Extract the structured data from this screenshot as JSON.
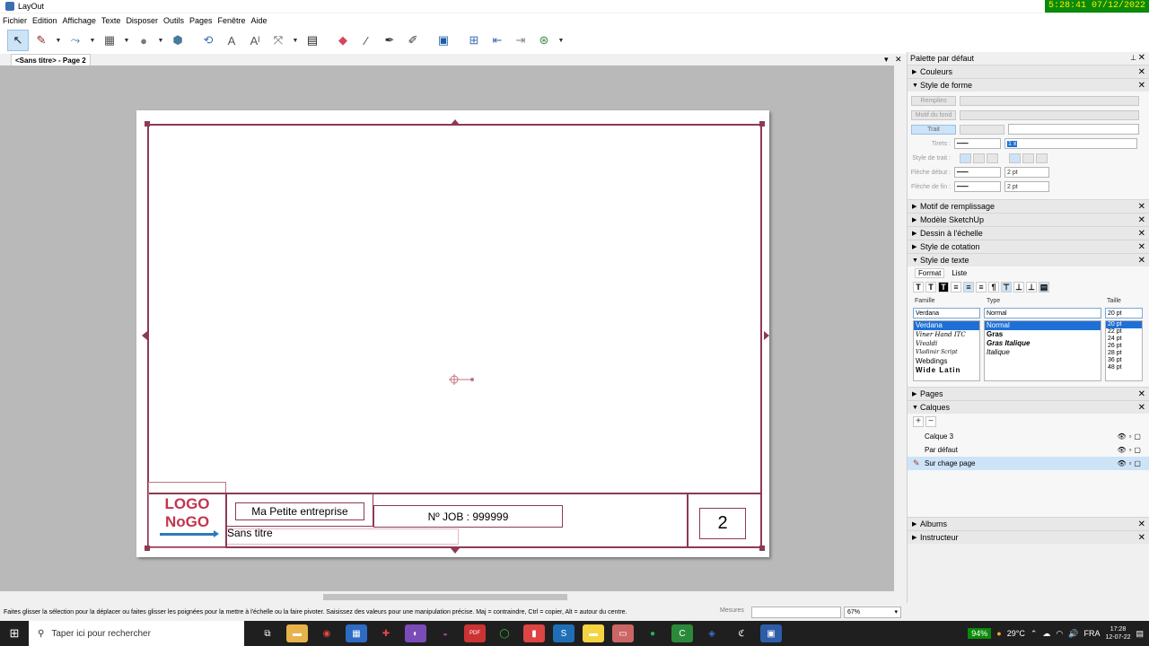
{
  "app": {
    "title": "LayOut",
    "clock": "5:28:41  07/12/2022"
  },
  "menu": [
    "Fichier",
    "Edition",
    "Affichage",
    "Texte",
    "Disposer",
    "Outils",
    "Pages",
    "Fenêtre",
    "Aide"
  ],
  "toolbar": {
    "tools": [
      {
        "name": "select-tool-icon",
        "glyph": "↖",
        "selected": true,
        "dropdown": false,
        "color": "#222222"
      },
      {
        "name": "line-tool-icon",
        "glyph": "✎",
        "selected": false,
        "dropdown": true,
        "color": "#8a2a2a"
      },
      {
        "name": "arc-tool-icon",
        "glyph": "⤳",
        "selected": false,
        "dropdown": true,
        "color": "#3a6fb0"
      },
      {
        "name": "rectangle-tool-icon",
        "glyph": "▦",
        "selected": false,
        "dropdown": true,
        "color": "#555555"
      },
      {
        "name": "circle-tool-icon",
        "glyph": "●",
        "selected": false,
        "dropdown": true,
        "color": "#777777"
      },
      {
        "name": "polygon-tool-icon",
        "glyph": "⬢",
        "selected": false,
        "dropdown": false,
        "color": "#4a7a9a"
      },
      {
        "name": "offset-tool-icon",
        "glyph": "⟲",
        "selected": false,
        "dropdown": false,
        "color": "#3a6fb0"
      },
      {
        "name": "text-tool-icon",
        "glyph": "A",
        "selected": false,
        "dropdown": false,
        "color": "#555555"
      },
      {
        "name": "label-tool-icon",
        "glyph": "Aᴵ",
        "selected": false,
        "dropdown": false,
        "color": "#555555"
      },
      {
        "name": "dimension-tool-icon",
        "glyph": "⤧",
        "selected": false,
        "dropdown": true,
        "color": "#555555"
      },
      {
        "name": "table-tool-icon",
        "glyph": "▤",
        "selected": false,
        "dropdown": false,
        "color": "#222222"
      },
      {
        "name": "eraser-tool-icon",
        "glyph": "◆",
        "selected": false,
        "dropdown": false,
        "color": "#d0485a"
      },
      {
        "name": "eyedropper-tool-icon",
        "glyph": "⁄",
        "selected": false,
        "dropdown": false,
        "color": "#333333"
      },
      {
        "name": "paint-bucket-icon",
        "glyph": "✒",
        "selected": false,
        "dropdown": false,
        "color": "#333333"
      },
      {
        "name": "split-tool-icon",
        "glyph": "✐",
        "selected": false,
        "dropdown": false,
        "color": "#333333"
      },
      {
        "name": "presentation-icon",
        "glyph": "▣",
        "selected": false,
        "dropdown": false,
        "color": "#1b5ea8"
      },
      {
        "name": "add-page-icon",
        "glyph": "⊞",
        "selected": false,
        "dropdown": false,
        "color": "#3a6fb0"
      },
      {
        "name": "previous-page-icon",
        "glyph": "⇤",
        "selected": false,
        "dropdown": false,
        "color": "#3a6fb0"
      },
      {
        "name": "next-page-icon",
        "glyph": "⇥",
        "selected": false,
        "dropdown": false,
        "color": "#888888"
      },
      {
        "name": "scale-tool-icon",
        "glyph": "⊛",
        "selected": false,
        "dropdown": true,
        "color": "#3a8a4a"
      }
    ]
  },
  "document": {
    "tab": "<Sans titre> - Page 2",
    "company": "Ma Petite entreprise",
    "job": "Nº JOB : 999999",
    "title": "Sans titre",
    "page_number": "2",
    "logo_line1": "LOGO",
    "logo_line2": "NoGO"
  },
  "panel": {
    "title": "Palette par défaut",
    "sections": {
      "colors": "Couleurs",
      "shape_style": "Style de forme",
      "pattern": "Motif de remplissage",
      "sketchup": "Modèle SketchUp",
      "scale": "Dessin à l'échelle",
      "dimension": "Style de cotation",
      "text_style": "Style de texte",
      "pages": "Pages",
      "layers": "Calques",
      "albums": "Albums",
      "instructor": "Instructeur"
    },
    "shape": {
      "fill": "Remplies",
      "pattern": "Motif du fond",
      "stroke": "Trait",
      "lines": "Tirets :",
      "stroke_style": "Style de trait :",
      "start_arrow": "Flèche début :",
      "end_arrow": "Flèche de fin :",
      "weight": "1 x",
      "start_size": "2 pt",
      "end_size": "2 pt"
    },
    "text": {
      "tab_format": "Format",
      "tab_list": "Liste",
      "family_label": "Famille",
      "type_label": "Type",
      "size_label": "Taille",
      "family_value": "Verdana",
      "type_value": "Normal",
      "size_value": "20 pt",
      "families": [
        "Verdana",
        "Viner Hand ITC",
        "Vivaldi",
        "Vladimir Script",
        "Webdings",
        "Wide Latin"
      ],
      "types": [
        "Normal",
        "Gras",
        "Gras Italique",
        "Italique"
      ],
      "sizes": [
        "20 pt",
        "22 pt",
        "24 pt",
        "26 pt",
        "28 pt",
        "36 pt",
        "48 pt"
      ]
    },
    "layers": [
      "Calque 3",
      "Par défaut",
      "Sur chage page"
    ]
  },
  "status": {
    "hint": "Faites glisser la sélection pour la déplacer ou faites glisser les poignées pour la mettre à l'échelle ou la faire pivoter. Saisissez des valeurs pour une manipulation précise. Maj = contraindre, Ctrl = copier, Alt = autour du centre.",
    "measures_label": "Mesures",
    "zoom": "67%"
  },
  "taskbar": {
    "search_placeholder": "Taper ici pour rechercher",
    "battery": "94%",
    "temperature": "29°C",
    "language": "FRA",
    "time": "17:28",
    "date": "12-07-22"
  }
}
